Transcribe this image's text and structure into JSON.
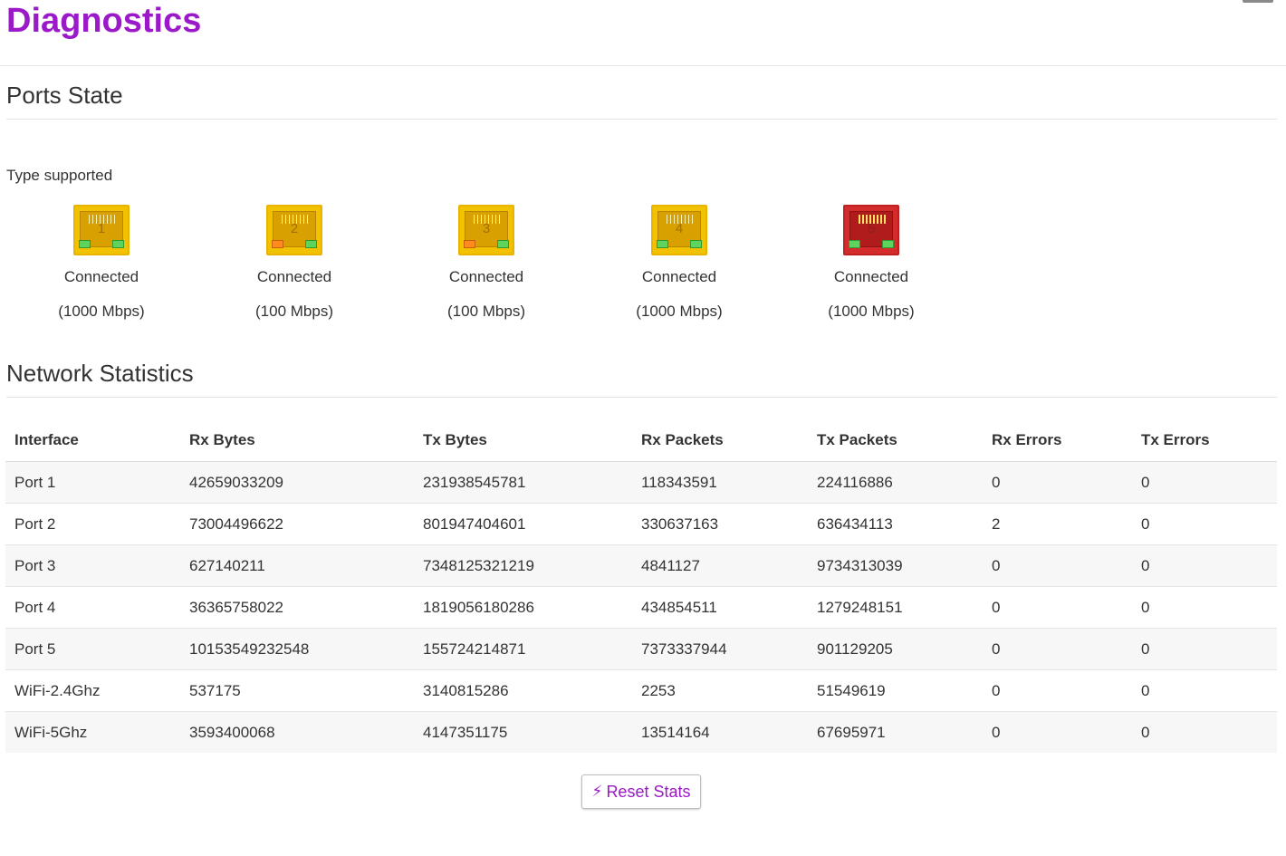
{
  "page": {
    "title": "Diagnostics"
  },
  "ports_state": {
    "title": "Ports State",
    "type_label": "Type supported",
    "ports": [
      {
        "number": "1",
        "status": "Connected",
        "speed": "(1000 Mbps)",
        "color": "yellow",
        "led_left": "green",
        "led_right": "green"
      },
      {
        "number": "2",
        "status": "Connected",
        "speed": "(100 Mbps)",
        "color": "yellow",
        "led_left": "orange",
        "led_right": "green"
      },
      {
        "number": "3",
        "status": "Connected",
        "speed": "(100 Mbps)",
        "color": "yellow",
        "led_left": "orange",
        "led_right": "green"
      },
      {
        "number": "4",
        "status": "Connected",
        "speed": "(1000 Mbps)",
        "color": "yellow",
        "led_left": "green",
        "led_right": "green"
      },
      {
        "number": "5",
        "status": "Connected",
        "speed": "(1000 Mbps)",
        "color": "red",
        "led_left": "green",
        "led_right": "green"
      }
    ]
  },
  "network_stats": {
    "title": "Network Statistics",
    "columns": [
      "Interface",
      "Rx Bytes",
      "Tx Bytes",
      "Rx Packets",
      "Tx Packets",
      "Rx Errors",
      "Tx Errors"
    ],
    "rows": [
      [
        "Port 1",
        "42659033209",
        "231938545781",
        "118343591",
        "224116886",
        "0",
        "0"
      ],
      [
        "Port 2",
        "73004496622",
        "801947404601",
        "330637163",
        "636434113",
        "2",
        "0"
      ],
      [
        "Port 3",
        "627140211",
        "7348125321219",
        "4841127",
        "9734313039",
        "0",
        "0"
      ],
      [
        "Port 4",
        "36365758022",
        "1819056180286",
        "434854511",
        "1279248151",
        "0",
        "0"
      ],
      [
        "Port 5",
        "10153549232548",
        "155724214871",
        "7373337944",
        "901129205",
        "0",
        "0"
      ],
      [
        "WiFi-2.4Ghz",
        "537175",
        "3140815286",
        "2253",
        "51549619",
        "0",
        "0"
      ],
      [
        "WiFi-5Ghz",
        "3593400068",
        "4147351175",
        "13514164",
        "67695971",
        "0",
        "0"
      ]
    ]
  },
  "actions": {
    "reset_label": "Reset Stats",
    "reset_icon": "bolt-icon"
  },
  "colors": {
    "accent": "#9b19c9",
    "port_yellow": "#f2c200",
    "port_red": "#d42c2c",
    "led_green": "#5ed35e",
    "led_orange": "#ff8a1e"
  }
}
